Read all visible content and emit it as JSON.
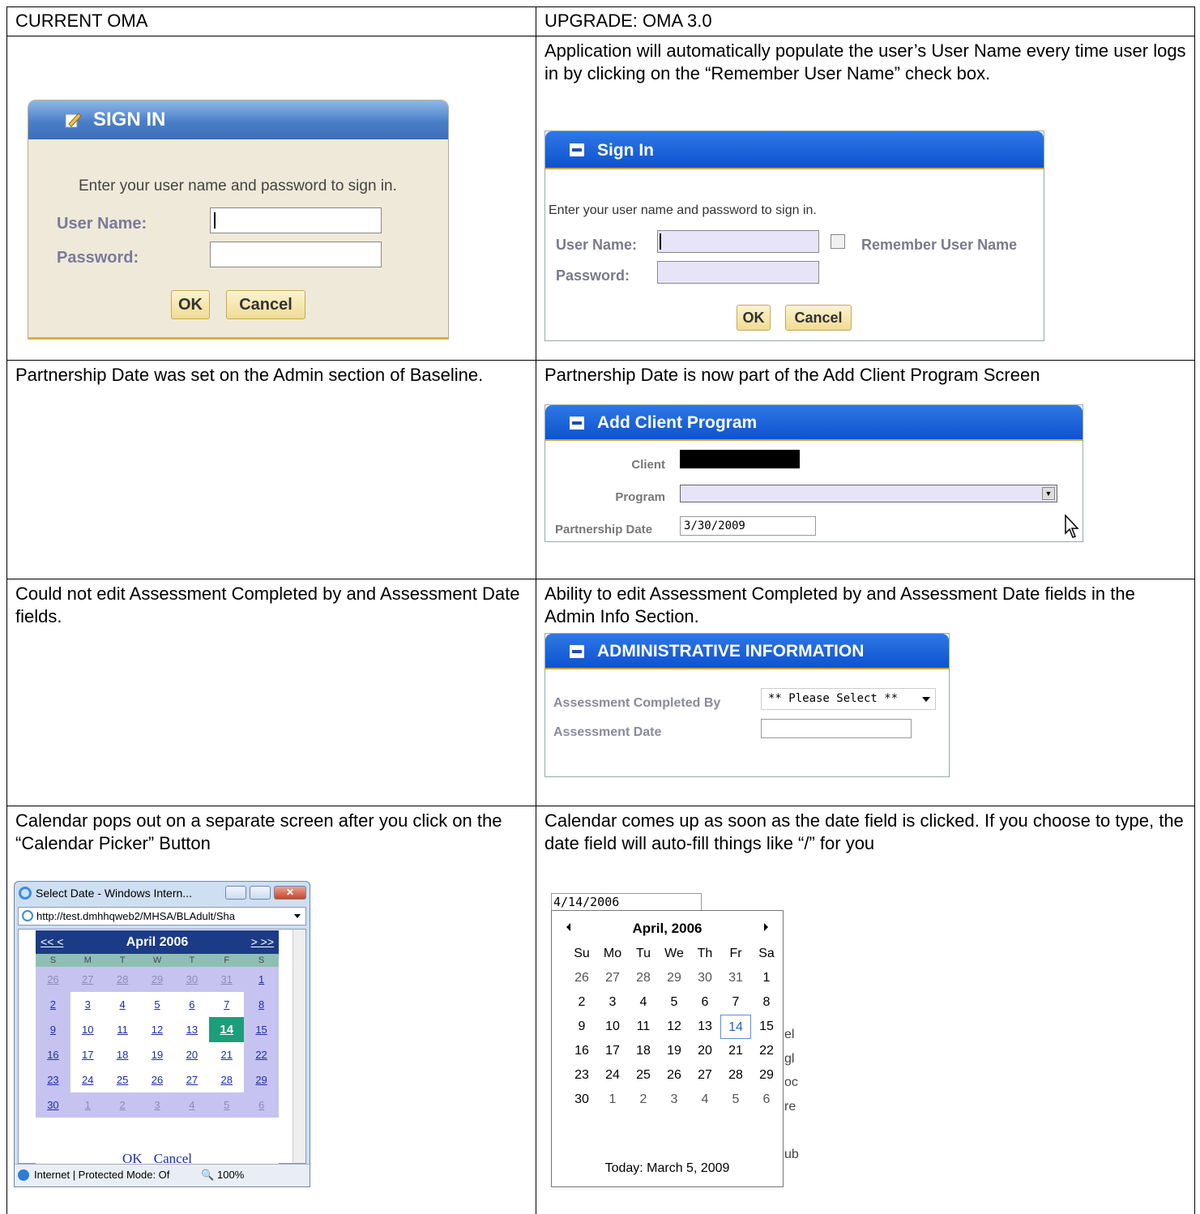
{
  "headers": {
    "left": "CURRENT OMA",
    "right": "UPGRADE: OMA 3.0"
  },
  "row1": {
    "right_text": "Application will automatically populate the user’s User Name every time user logs in by clicking on the “Remember User Name” check box.",
    "old_signin": {
      "title": "SIGN IN",
      "intro": "Enter your user name and password to sign in.",
      "user_label": "User Name:",
      "password_label": "Password:",
      "ok": "OK",
      "cancel": "Cancel"
    },
    "new_signin": {
      "title": "Sign In",
      "intro": "Enter your user name and password to sign in.",
      "user_label": "User Name:",
      "password_label": "Password:",
      "remember": "Remember User Name",
      "ok": "OK",
      "cancel": "Cancel"
    }
  },
  "row2": {
    "left_text": "Partnership Date was set on the Admin section of Baseline.",
    "right_text": "Partnership Date is now part of the Add Client Program Screen",
    "panel": {
      "title": "Add Client Program",
      "client_label": "Client",
      "program_label": "Program",
      "partnership_label": "Partnership Date",
      "partnership_value": "3/30/2009"
    }
  },
  "row3": {
    "left_text": "Could not edit Assessment Completed by and Assessment Date fields.",
    "right_text": "Ability to edit Assessment Completed by and Assessment Date fields in the Admin Info Section.",
    "panel": {
      "title": "ADMINISTRATIVE INFORMATION",
      "completed_by_label": "Assessment Completed By",
      "completed_by_value": "** Please Select **",
      "date_label": "Assessment Date"
    }
  },
  "row4": {
    "left_text": "Calendar pops out on a separate screen after you click on the “Calendar Picker” Button",
    "right_text": "Calendar comes up as soon as the date field is clicked. If you choose to type, the date field will auto-fill things like “/” for you",
    "old_calendar": {
      "window_title": "Select Date - Windows Intern...",
      "address": "http://test.dmhhqweb2/MHSA/BLAdult/Sha",
      "nav_prev": "<< <",
      "month": "April 2006",
      "nav_next": "> >>",
      "dow": [
        "S",
        "M",
        "T",
        "W",
        "T",
        "F",
        "S"
      ],
      "days": [
        "26",
        "27",
        "28",
        "29",
        "30",
        "31",
        "1",
        "2",
        "3",
        "4",
        "5",
        "6",
        "7",
        "8",
        "9",
        "10",
        "11",
        "12",
        "13",
        "14",
        "15",
        "16",
        "17",
        "18",
        "19",
        "20",
        "21",
        "22",
        "23",
        "24",
        "25",
        "26",
        "27",
        "28",
        "29",
        "30",
        "1",
        "2",
        "3",
        "4",
        "5",
        "6"
      ],
      "ok": "OK",
      "cancel": "Cancel",
      "status": "Internet | Protected Mode: Of",
      "zoom": "100%"
    },
    "new_calendar": {
      "input_value": "4/14/2006",
      "month": "April, 2006",
      "dow": [
        "Su",
        "Mo",
        "Tu",
        "We",
        "Th",
        "Fr",
        "Sa"
      ],
      "days": [
        "26",
        "27",
        "28",
        "29",
        "30",
        "31",
        "1",
        "2",
        "3",
        "4",
        "5",
        "6",
        "7",
        "8",
        "9",
        "10",
        "11",
        "12",
        "13",
        "14",
        "15",
        "16",
        "17",
        "18",
        "19",
        "20",
        "21",
        "22",
        "23",
        "24",
        "25",
        "26",
        "27",
        "28",
        "29",
        "30",
        "1",
        "2",
        "3",
        "4",
        "5",
        "6"
      ],
      "today": "Today: March 5, 2009"
    }
  }
}
